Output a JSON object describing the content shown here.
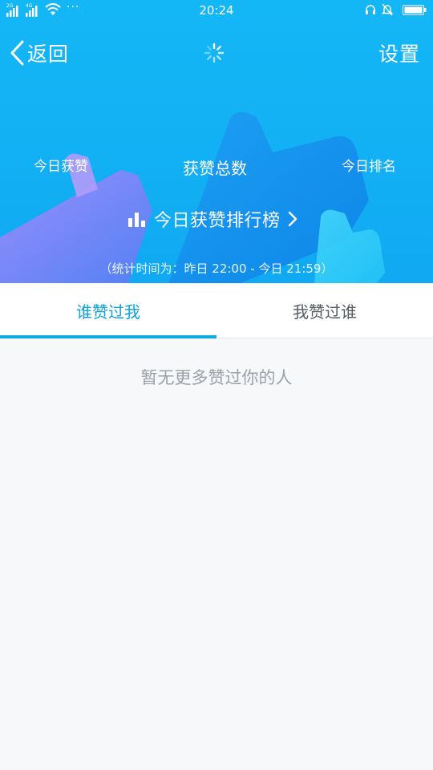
{
  "status_bar": {
    "time": "20:24",
    "network_1": "2G",
    "network_2": "4G",
    "more": "···",
    "icons": [
      "signal-icon",
      "signal-icon",
      "wifi-icon",
      "headset-icon",
      "bell-off-icon",
      "battery-icon"
    ]
  },
  "nav": {
    "back_label": "返回",
    "settings_label": "设置",
    "loading_icon": "spinner-icon"
  },
  "stats": {
    "today_likes_label": "今日获赞",
    "total_likes_label": "获赞总数",
    "today_rank_label": "今日排名",
    "ranking_link_label": "今日获赞排行榜",
    "stat_period_note": "（统计时间为：昨日 22:00 - 今日 21:59）"
  },
  "tabs": [
    {
      "label": "谁赞过我",
      "active": true
    },
    {
      "label": "我赞过谁",
      "active": false
    }
  ],
  "empty_state": {
    "message": "暂无更多赞过你的人"
  },
  "colors": {
    "header_blue": "#12b0f4",
    "tab_active": "#0ea3d6",
    "page_bg": "#f7f8fa"
  }
}
